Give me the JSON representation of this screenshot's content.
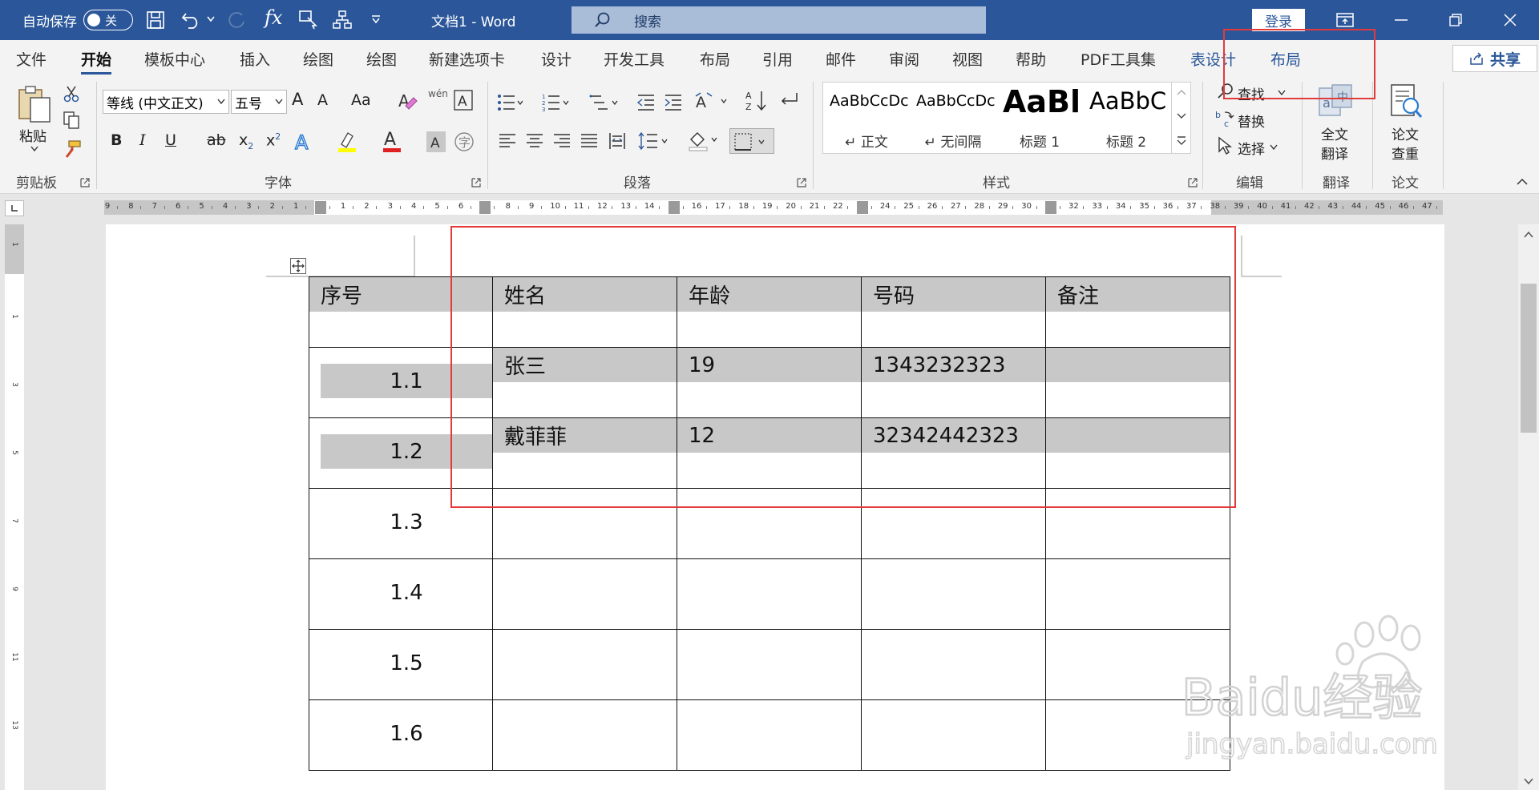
{
  "titlebar": {
    "autosave_label": "自动保存",
    "autosave_state": "关",
    "doc_title": "文档1  -  Word",
    "search_placeholder": "搜索",
    "login_label": "登录"
  },
  "tabs": [
    {
      "label": "文件",
      "active": false,
      "contextual": false
    },
    {
      "label": "开始",
      "active": true,
      "contextual": false
    },
    {
      "label": "模板中心",
      "active": false,
      "contextual": false
    },
    {
      "label": "插入",
      "active": false,
      "contextual": false
    },
    {
      "label": "绘图",
      "active": false,
      "contextual": false
    },
    {
      "label": "绘图",
      "active": false,
      "contextual": false
    },
    {
      "label": "新建选项卡",
      "active": false,
      "contextual": false
    },
    {
      "label": "设计",
      "active": false,
      "contextual": false
    },
    {
      "label": "开发工具",
      "active": false,
      "contextual": false
    },
    {
      "label": "布局",
      "active": false,
      "contextual": false
    },
    {
      "label": "引用",
      "active": false,
      "contextual": false
    },
    {
      "label": "邮件",
      "active": false,
      "contextual": false
    },
    {
      "label": "审阅",
      "active": false,
      "contextual": false
    },
    {
      "label": "视图",
      "active": false,
      "contextual": false
    },
    {
      "label": "帮助",
      "active": false,
      "contextual": false
    },
    {
      "label": "PDF工具集",
      "active": false,
      "contextual": false
    },
    {
      "label": "表设计",
      "active": false,
      "contextual": true
    },
    {
      "label": "布局",
      "active": false,
      "contextual": true
    }
  ],
  "share_label": "共享",
  "ribbon": {
    "clipboard": {
      "paste_label": "粘贴",
      "group_label": "剪贴板"
    },
    "font": {
      "font_name": "等线 (中文正文)",
      "font_size": "五号",
      "bold": "B",
      "italic": "I",
      "underline": "U",
      "strike": "ab",
      "subscript": "x",
      "superscript": "x",
      "grow": "A",
      "shrink": "A",
      "case": "Aa",
      "wen": "wén",
      "group_label": "字体"
    },
    "paragraph": {
      "group_label": "段落"
    },
    "styles": {
      "items": [
        {
          "preview": "AaBbCcDc",
          "name": "↵ 正文"
        },
        {
          "preview": "AaBbCcDc",
          "name": "↵ 无间隔"
        },
        {
          "preview": "AaBl",
          "name": "标题 1"
        },
        {
          "preview": "AaBbC",
          "name": "标题 2"
        }
      ],
      "group_label": "样式"
    },
    "editing": {
      "find": "查找",
      "replace": "替换",
      "select": "选择",
      "group_label": "编辑"
    },
    "translate": {
      "button": "全文\n翻译",
      "button_l1": "全文",
      "button_l2": "翻译",
      "group_label": "翻译"
    },
    "paper": {
      "button_l1": "论文",
      "button_l2": "查重",
      "group_label": "论文"
    }
  },
  "ruler_numbers": [
    "9",
    "8",
    "7",
    "6",
    "5",
    "4",
    "3",
    "2",
    "1",
    "",
    "1",
    "2",
    "3",
    "4",
    "5",
    "6",
    "",
    "8",
    "9",
    "10",
    "11",
    "12",
    "13",
    "14",
    "",
    "16",
    "17",
    "18",
    "19",
    "20",
    "21",
    "22",
    "",
    "24",
    "25",
    "26",
    "27",
    "28",
    "29",
    "30",
    "",
    "32",
    "33",
    "34",
    "35",
    "36",
    "37",
    "38",
    "39",
    "40",
    "41",
    "42",
    "43",
    "44",
    "45",
    "46",
    "47"
  ],
  "vruler_numbers": [
    "1",
    "1",
    "3",
    "5",
    "7",
    "9",
    "11",
    "13"
  ],
  "table": {
    "headers": [
      "序号",
      "姓名",
      "年龄",
      "号码",
      "备注"
    ],
    "rows": [
      [
        "1.1",
        "张三",
        "19",
        "1343232323",
        ""
      ],
      [
        "1.2",
        "戴菲菲",
        "12",
        "32342442323",
        ""
      ],
      [
        "1.3",
        "",
        "",
        "",
        ""
      ],
      [
        "1.4",
        "",
        "",
        "",
        ""
      ],
      [
        "1.5",
        "",
        "",
        "",
        ""
      ],
      [
        "1.6",
        "",
        "",
        "",
        ""
      ]
    ]
  },
  "watermark": {
    "logo": "Baidu经验",
    "url": "jingyan.baidu.com"
  },
  "colors": {
    "titlebar": "#2b579a",
    "highlight_box": "#e23a3a",
    "shading": "#c8c8c8"
  }
}
